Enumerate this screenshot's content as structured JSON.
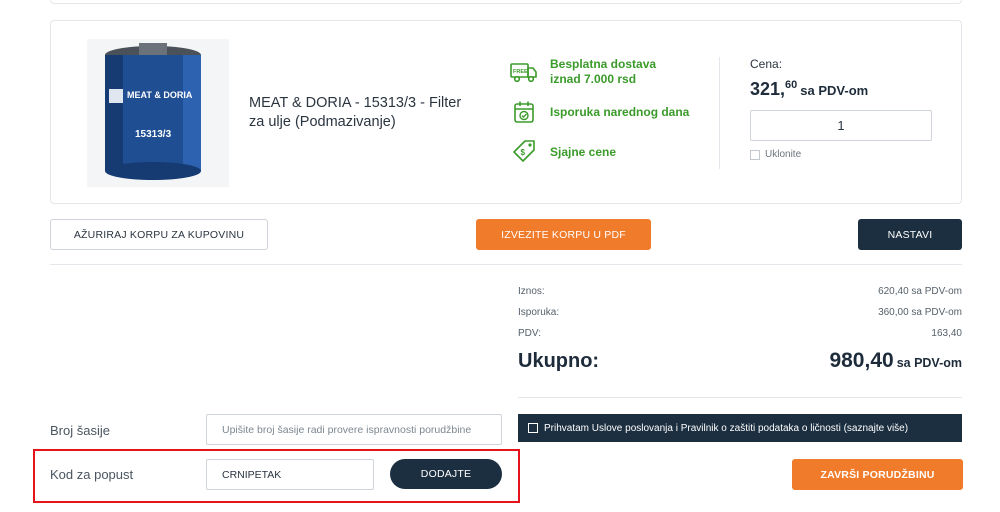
{
  "product": {
    "name": "MEAT & DORIA - 15313/3 - Filter za ulje (Podmazivanje)",
    "image_brand_text": "MEAT & DORIA",
    "image_part_text": "15313/3",
    "features": [
      {
        "icon": "free-delivery-truck-icon",
        "text": "Besplatna dostava iznad 7.000 rsd"
      },
      {
        "icon": "calendar-icon",
        "text": "Isporuka narednog dana"
      },
      {
        "icon": "price-tag-icon",
        "text": "Sjajne cene"
      }
    ],
    "price_label": "Cena:",
    "price_int": "321,",
    "price_dec": "60",
    "price_suffix": "sa PDV-om",
    "quantity": "1",
    "remove_label": "Uklonite"
  },
  "actions": {
    "update_cart": "AŽURIRAJ KORPU ZA KUPOVINU",
    "export_pdf": "IZVEZITE KORPU U PDF",
    "continue": "NASTAVI"
  },
  "summary": {
    "rows": [
      {
        "label": "Iznos:",
        "value": "620,40 sa PDV-om"
      },
      {
        "label": "Isporuka:",
        "value": "360,00 sa PDV-om"
      },
      {
        "label": "PDV:",
        "value": "163,40"
      }
    ],
    "total_label": "Ukupno:",
    "total_value": "980,40",
    "total_suffix": "sa PDV-om",
    "terms_text": "Prihvatam Uslove poslovanja i Pravilnik o zaštiti podataka o ličnosti (saznajte više)"
  },
  "form": {
    "chassis_label": "Broj šasije",
    "chassis_placeholder": "Upišite broj šasije radi provere ispravnosti porudžbine",
    "coupon_label": "Kod za popust",
    "coupon_value": "CRNIPETAK",
    "add_button": "DODAJTE",
    "finish_button": "ZAVRŠI PORUDŽBINU"
  },
  "colors": {
    "accent_orange": "#f07c2b",
    "navy": "#1c2f40",
    "feature_green": "#3b9b2a",
    "highlight_red": "#e5141b"
  }
}
